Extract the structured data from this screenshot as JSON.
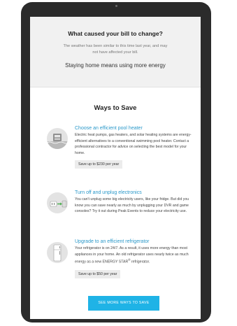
{
  "bill_change": {
    "title": "What caused your bill to change?",
    "weather_note": "The weather has been similar to this time last year, and may not have affected your bill.",
    "reason": "Staying home means using more energy"
  },
  "ways_to_save": {
    "title": "Ways to Save",
    "tips": [
      {
        "title": "Choose an efficient pool heater",
        "text": "Electric heat pumps, gas heaters, and solar heating systems are energy-efficient alternatives to a conventional swimming pool heater. Contact a professional contractor for advice on selecting the best model for your home.",
        "savings": "Save up to $230 per year",
        "icon": "pool-heater-icon"
      },
      {
        "title": "Turn off and unplug electronics",
        "text": "You can't unplug some big electricity users, like your fridge. But did you know you can save nearly as much by unplugging your DVR and game consoles? Try it out during Peak Events to reduce your electricity use.",
        "icon": "plug-icon"
      },
      {
        "title": "Upgrade to an efficient refrigerator",
        "text_part1": "Your refrigerator is on 24/7. As a result, it uses more energy than most appliances in your home. An old refrigerator uses nearly twice as much energy as a new ENERGY STAR",
        "text_sup": "®",
        "text_part2": " refrigerator.",
        "savings": "Save up to $50 per year",
        "icon": "refrigerator-icon"
      }
    ],
    "cta_label": "SEE MORE WAYS TO SAVE"
  },
  "colors": {
    "accent": "#2a98c9",
    "cta": "#1fb3e6",
    "top_bg": "#f1f1f1",
    "bezel": "#2b2b2b"
  }
}
